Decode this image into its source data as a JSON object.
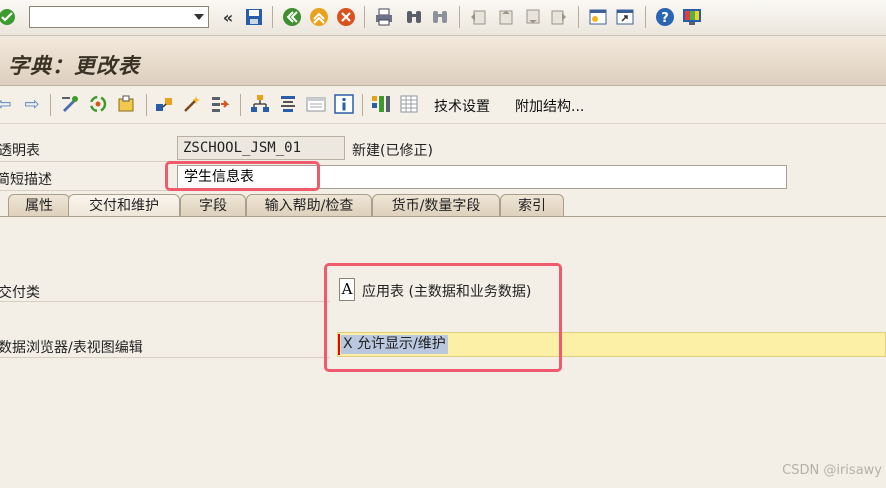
{
  "toolbar": {
    "command_field_value": ""
  },
  "title": "字典：更改表",
  "app_toolbar": {
    "tech_settings_label": "技术设置",
    "append_structure_label": "附加结构..."
  },
  "header": {
    "table_label": "透明表",
    "table_name": "ZSCHOOL_JSM_01",
    "table_status": "新建(已修正)",
    "short_desc_label": "简短描述",
    "short_desc_value": "学生信息表"
  },
  "tabs": [
    {
      "label": "属性"
    },
    {
      "label": "交付和维护"
    },
    {
      "label": "字段"
    },
    {
      "label": "输入帮助/检查"
    },
    {
      "label": "货币/数量字段"
    },
    {
      "label": "索引"
    }
  ],
  "delivery": {
    "class_label": "交付类",
    "class_code": "A",
    "class_text": "应用表 (主数据和业务数据)"
  },
  "maintenance": {
    "label": "数据浏览器/表视图编辑",
    "value": "X 允许显示/维护"
  },
  "watermark": "CSDN @irisawy"
}
